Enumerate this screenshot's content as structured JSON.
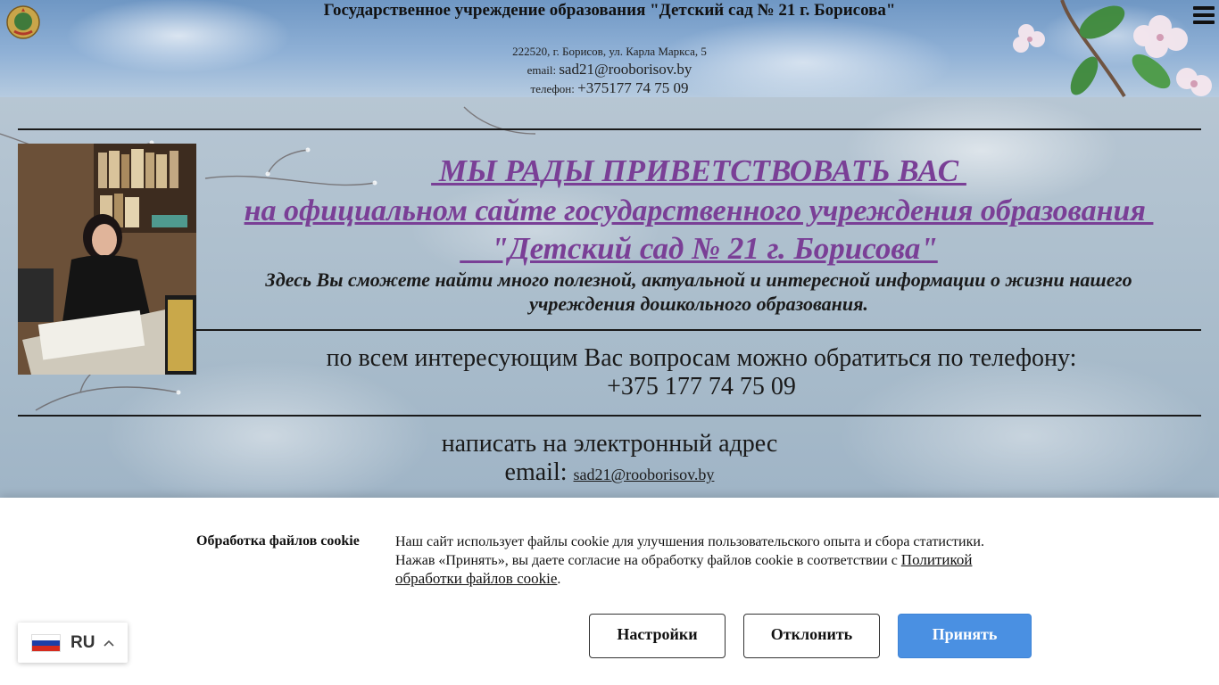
{
  "header": {
    "title": "Государственное учреждение образования \"Детский сад № 21 г. Борисова\"",
    "address": "222520, г. Борисов, ул. Карла Маркса, 5",
    "email_label": "email:",
    "email_value": "sad21@rooborisov.by",
    "phone_label": "телефон:",
    "phone_value": "+375177 74 75 09",
    "emblem_icon": "emblem-icon",
    "menu_icon": "hamburger-menu-icon"
  },
  "main": {
    "welcome_line1": " МЫ РАДЫ ПРИВЕТСТВОВАТЬ ВАС ",
    "welcome_line2": "на официальном сайте государственного учреждения образования ",
    "welcome_line3": "    \"Детский сад № 21 г. Борисова\"",
    "welcome_text": "Здесь  Вы сможете найти много полезной, актуальной и интересной информации о жизни нашего учреждения дошкольного образования.",
    "contact_label": "по всем интересующим Вас вопросам можно обратиться по телефону:",
    "contact_phone": "+375 177 74 75 09",
    "email_prompt": "написать на электронный адрес",
    "email_label": "email:",
    "email_link": "sad21@rooborisov.by"
  },
  "cookie": {
    "title": "Обработка файлов cookie",
    "text": "Наш сайт использует файлы cookie для улучшения пользовательского опыта и сбора статистики. Нажав «Принять», вы даете согласие на обработку файлов cookie в соответствии с ",
    "policy_link": "Политикой обработки файлов cookie",
    "text_end": ".",
    "settings_label": "Настройки",
    "reject_label": "Отклонить",
    "accept_label": "Принять",
    "accent_color": "#4a90e2"
  },
  "language": {
    "code": "RU",
    "flag_icon": "russia-flag-icon",
    "chevron_icon": "chevron-up-icon"
  },
  "colors": {
    "welcome_heading": "#7a3f96"
  }
}
